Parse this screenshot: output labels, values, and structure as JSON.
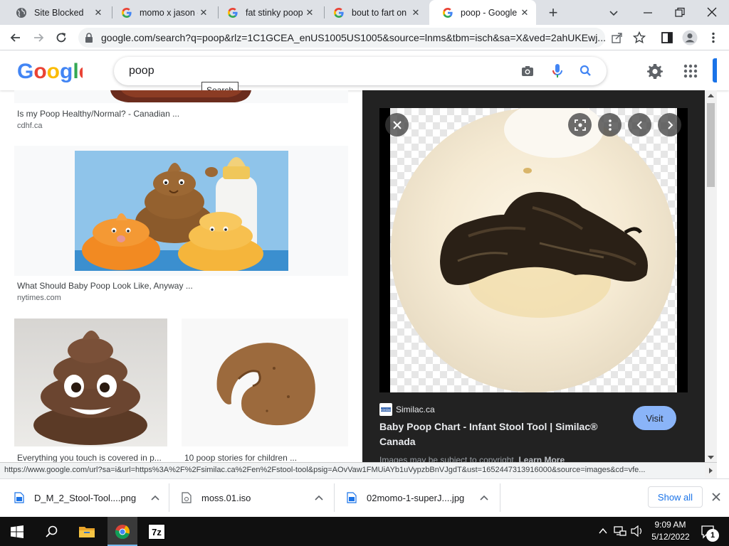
{
  "tabs": [
    {
      "title": "Site Blocked",
      "icon": "globe-icon"
    },
    {
      "title": "momo x jason -",
      "icon": "google-g-icon"
    },
    {
      "title": "fat stinky poop",
      "icon": "google-g-icon"
    },
    {
      "title": "bout to fart on",
      "icon": "google-g-icon"
    },
    {
      "title": "poop - Google",
      "icon": "google-g-icon",
      "active": true
    }
  ],
  "address_bar": {
    "url": "google.com/search?q=poop&rlz=1C1GCEA_enUS1005US1005&source=lnms&tbm=isch&sa=X&ved=2ahUKEwj..."
  },
  "search": {
    "query": "poop",
    "tooltip": "Search"
  },
  "results": [
    {
      "caption": "Is my Poop Healthy/Normal? - Canadian ...",
      "source": "cdhf.ca"
    },
    {
      "caption": "What Should Baby Poop Look Like, Anyway ...",
      "source": "nytimes.com"
    },
    {
      "caption": "Everything you touch is covered in p...",
      "source": ""
    },
    {
      "caption": "10 poop stories for children ...",
      "source": ""
    }
  ],
  "preview": {
    "site": "Similac.ca",
    "title_line1": "Baby Poop Chart - Infant Stool Tool | Similac®",
    "title_line2": "Canada",
    "visit_label": "Visit",
    "copyright_text": "Images may be subject to copyright.",
    "learn_more": "Learn More"
  },
  "status_url": "https://www.google.com/url?sa=i&url=https%3A%2F%2Fsimilac.ca%2Fen%2Fstool-tool&psig=AOvVaw1FMUiAYb1uVypzbBnVJgdT&ust=1652447313916000&source=images&cd=vfe...",
  "downloads": [
    {
      "name": "D_M_2_Stool-Tool....png"
    },
    {
      "name": "moss.01.iso"
    },
    {
      "name": "02momo-1-superJ....jpg"
    }
  ],
  "show_all_label": "Show all",
  "taskbar": {
    "time": "9:09 AM",
    "date": "5/12/2022",
    "notification_count": "1",
    "sevenzip_label": "7z"
  },
  "colors": {
    "tab_strip": "#dee1e6",
    "google_blue": "#4285f4",
    "google_red": "#ea4335",
    "google_yellow": "#fbbc05",
    "google_green": "#34a853",
    "panel_bg": "#222222",
    "visit_button": "#8ab4f8",
    "taskbar": "#101010"
  }
}
